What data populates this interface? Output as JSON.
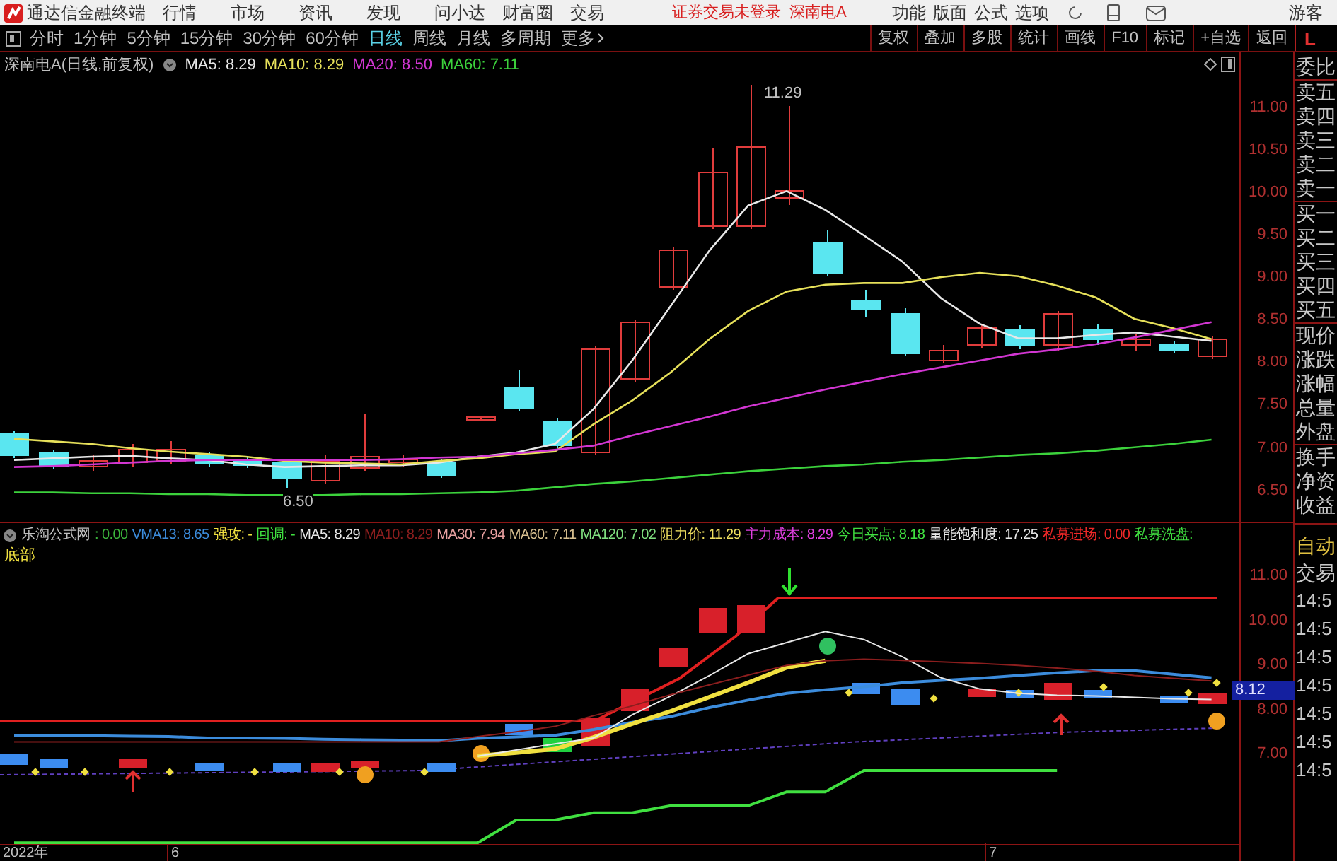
{
  "menu_bar": {
    "app_title": "通达信金融终端",
    "menus": [
      "行情",
      "市场",
      "资讯",
      "发现",
      "问小达",
      "财富圈",
      "交易"
    ],
    "login_status": "证券交易未登录",
    "stock_name": "深南电A",
    "right_menus": [
      "功能",
      "版面",
      "公式",
      "选项"
    ],
    "user": "游客"
  },
  "period_tabs": [
    {
      "label": "分时",
      "selected": false
    },
    {
      "label": "1分钟",
      "selected": false
    },
    {
      "label": "5分钟",
      "selected": false
    },
    {
      "label": "15分钟",
      "selected": false
    },
    {
      "label": "30分钟",
      "selected": false
    },
    {
      "label": "60分钟",
      "selected": false
    },
    {
      "label": "日线",
      "selected": true
    },
    {
      "label": "周线",
      "selected": false
    },
    {
      "label": "月线",
      "selected": false
    },
    {
      "label": "多周期",
      "selected": false
    },
    {
      "label": "更多",
      "selected": false
    }
  ],
  "tool_buttons": [
    "复权",
    "叠加",
    "多股",
    "统计",
    "画线",
    "F10",
    "标记",
    "+自选",
    "返回"
  ],
  "side_mode": "L",
  "main_chart": {
    "title": "深南电A(日线,前复权)",
    "readings": [
      ": 8.29",
      ": 8.29",
      ": 8.50",
      ": 7.11"
    ],
    "high_label": "11.29",
    "low_label": "6.50",
    "chart_data": {
      "type": "line",
      "ylim": [
        6.12,
        11.65
      ],
      "yticks": [
        {
          "value": 11,
          "label": "11.00"
        },
        {
          "value": 10.5,
          "label": "10.50"
        },
        {
          "value": 10,
          "label": "10.00"
        },
        {
          "value": 9.5,
          "label": "9.50"
        },
        {
          "value": 9,
          "label": "9.00"
        },
        {
          "value": 8.5,
          "label": "8.50"
        },
        {
          "value": 8,
          "label": "8.00"
        },
        {
          "value": 7.5,
          "label": "7.50"
        },
        {
          "value": 7,
          "label": "7.00"
        },
        {
          "value": 6.5,
          "label": "6.50"
        }
      ],
      "series": [
        {
          "name": "MA5",
          "color": "#e8e8e8",
          "values": [
            6.86,
            6.88,
            6.9,
            6.91,
            6.88,
            6.86,
            6.81,
            6.78,
            6.79,
            6.8,
            6.8,
            6.83,
            6.9,
            6.95,
            7.05,
            7.46,
            8.03,
            8.67,
            9.32,
            9.85,
            10.02,
            9.8,
            9.5,
            9.19,
            8.76,
            8.46,
            8.29,
            8.29,
            8.33,
            8.36,
            8.31,
            8.26
          ]
        },
        {
          "name": "MA10",
          "color": "#e6e05a",
          "values": [
            7.11,
            7.08,
            7.05,
            7.0,
            6.96,
            6.93,
            6.9,
            6.85,
            6.83,
            6.82,
            6.81,
            6.85,
            6.88,
            6.93,
            6.96,
            7.28,
            7.56,
            7.89,
            8.28,
            8.61,
            8.84,
            8.92,
            8.94,
            8.94,
            9.01,
            9.06,
            9.02,
            8.91,
            8.77,
            8.52,
            8.41,
            8.28
          ]
        },
        {
          "name": "MA20",
          "color": "#d236d2",
          "values": [
            6.78,
            6.79,
            6.81,
            6.83,
            6.85,
            6.86,
            6.86,
            6.86,
            6.86,
            6.86,
            6.87,
            6.89,
            6.9,
            6.94,
            6.98,
            7.03,
            7.15,
            7.26,
            7.37,
            7.49,
            7.59,
            7.69,
            7.78,
            7.87,
            7.95,
            8.03,
            8.11,
            8.16,
            8.22,
            8.3,
            8.39,
            8.48
          ]
        },
        {
          "name": "MA60",
          "color": "#3cd23c",
          "values": [
            6.48,
            6.48,
            6.47,
            6.47,
            6.46,
            6.46,
            6.45,
            6.45,
            6.45,
            6.46,
            6.46,
            6.47,
            6.48,
            6.5,
            6.54,
            6.58,
            6.61,
            6.65,
            6.69,
            6.73,
            6.76,
            6.79,
            6.81,
            6.84,
            6.86,
            6.89,
            6.92,
            6.94,
            6.97,
            7.01,
            7.05,
            7.1
          ]
        }
      ]
    }
  },
  "side_panel": {
    "groups": [
      [
        "委比"
      ],
      [
        "卖五",
        "卖四",
        "卖三",
        "卖二",
        "卖一"
      ],
      [
        "买一",
        "买二",
        "买三",
        "买四",
        "买五"
      ],
      [
        "现价",
        "涨跌",
        "涨幅",
        "总量",
        "外盘"
      ],
      [
        "换手",
        "净资",
        "收益"
      ]
    ]
  },
  "indicator_panel": {
    "title": "乐淘公式网",
    "legend": [
      {
        "kind": "text",
        "reading": ": 0.00",
        "color": "#3cb43c"
      },
      {
        "kind": "series",
        "reading": ": 8.65"
      },
      {
        "kind": "series",
        "reading": ": -"
      },
      {
        "kind": "series",
        "reading": ": -"
      },
      {
        "kind": "series",
        "reading": ": 8.29"
      },
      {
        "kind": "series",
        "reading": ": 8.29"
      },
      {
        "kind": "text",
        "name": "MA30",
        "reading": ": 7.94",
        "color": "#e8a0a0"
      },
      {
        "kind": "text",
        "name": "MA60",
        "reading": ": 7.11",
        "color": "#d8c090"
      },
      {
        "kind": "text",
        "name": "MA120",
        "reading": ": 7.02",
        "color": "#80e080"
      },
      {
        "kind": "text",
        "name": "阻力价",
        "reading": ": 11.29",
        "color": "#f0e060"
      },
      {
        "kind": "text",
        "name": "主力成本",
        "reading": ": 8.29",
        "color": "#e040e0"
      },
      {
        "kind": "text",
        "name": "今日买点",
        "reading": ": 8.18",
        "color": "#40e040"
      },
      {
        "kind": "text",
        "name": "量能饱和度",
        "reading": ": 17.25",
        "color": "#e8e8e8"
      },
      {
        "kind": "text",
        "name": "私募进场",
        "reading": ": 0.00",
        "color": "#f02828"
      },
      {
        "kind": "text",
        "name": "私募洗盘",
        "reading": ":",
        "color": "#40e040"
      }
    ],
    "signal_label": "底部",
    "current_price": "8.12",
    "chart_data": {
      "type": "line",
      "ylim": [
        5.0,
        12.2
      ],
      "yticks": [
        {
          "value": 11,
          "label": "11.00"
        },
        {
          "value": 10,
          "label": "10.00"
        },
        {
          "value": 9,
          "label": "9.00"
        },
        {
          "value": 8,
          "label": "8.00"
        },
        {
          "value": 7,
          "label": "7.00"
        }
      ],
      "series": [
        {
          "name": "VMA13",
          "color": "#3c8cdc",
          "values": [
            7.44,
            7.44,
            7.43,
            7.42,
            7.41,
            7.38,
            7.38,
            7.37,
            7.35,
            7.34,
            7.33,
            7.32,
            7.37,
            7.4,
            7.44,
            7.57,
            7.73,
            7.86,
            8.06,
            8.23,
            8.38,
            8.46,
            8.53,
            8.62,
            8.67,
            8.72,
            8.78,
            8.84,
            8.89,
            8.89,
            8.81,
            8.73
          ]
        },
        {
          "name": "强攻",
          "color": "#f0e040",
          "values": [
            null,
            null,
            null,
            null,
            null,
            null,
            null,
            null,
            null,
            null,
            null,
            null,
            6.98,
            7.05,
            7.13,
            7.39,
            7.7,
            7.98,
            8.3,
            8.62,
            8.96,
            9.11,
            null,
            null,
            null,
            null,
            null,
            null,
            null,
            null,
            null,
            null
          ]
        },
        {
          "name": "回调",
          "color": "#40e040",
          "values": [
            5.03,
            5.03,
            5.03,
            5.03,
            5.03,
            5.03,
            5.03,
            5.03,
            5.03,
            5.03,
            5.03,
            5.03,
            5.03,
            5.54,
            5.54,
            5.7,
            5.7,
            5.86,
            5.86,
            5.86,
            6.17,
            6.17,
            6.65,
            6.65,
            6.65,
            6.65,
            6.65,
            6.65,
            null,
            null,
            null,
            null
          ]
        },
        {
          "name": "MA5",
          "color": "#e8e8e8",
          "values": [
            null,
            null,
            null,
            null,
            null,
            null,
            null,
            null,
            null,
            null,
            null,
            null,
            6.97,
            7.11,
            7.25,
            7.38,
            7.9,
            8.32,
            8.78,
            9.27,
            9.52,
            9.77,
            9.59,
            9.2,
            8.73,
            8.48,
            8.38,
            8.34,
            8.32,
            8.29,
            8.26,
            8.24
          ]
        },
        {
          "name": "MA10",
          "color": "#8c1e1e",
          "values": [
            7.29,
            7.29,
            7.29,
            7.29,
            7.29,
            7.29,
            7.29,
            7.29,
            7.29,
            7.29,
            7.29,
            7.29,
            7.41,
            7.52,
            7.64,
            7.88,
            8.1,
            8.35,
            8.57,
            8.79,
            9.01,
            9.11,
            9.15,
            9.12,
            9.09,
            9.05,
            9.01,
            8.95,
            8.88,
            8.78,
            8.72,
            8.66
          ]
        }
      ]
    }
  },
  "trade_panel": {
    "labels": [
      "自动",
      "交易"
    ],
    "times": [
      "14:5",
      "14:5",
      "14:5",
      "14:5",
      "14:5",
      "14:5",
      "14:5"
    ]
  },
  "x_axis": [
    {
      "label": "2022年"
    },
    {
      "label": "6"
    },
    {
      "label": "7"
    }
  ]
}
